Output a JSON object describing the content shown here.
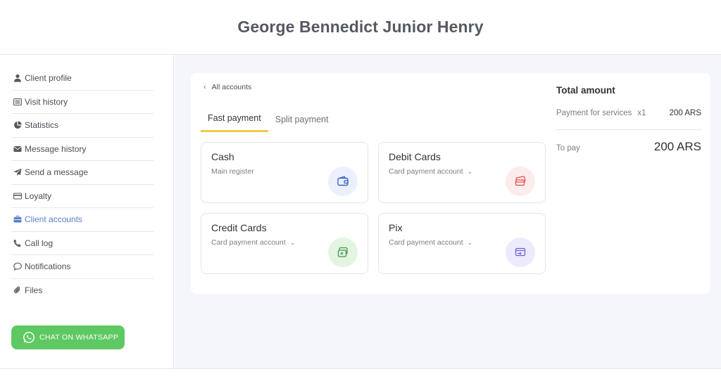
{
  "header": {
    "title": "George Bennedict Junior Henry"
  },
  "sidebar": {
    "items": [
      {
        "label": "Client profile",
        "icon": "user-icon"
      },
      {
        "label": "Visit history",
        "icon": "list-icon"
      },
      {
        "label": "Statistics",
        "icon": "pie-chart-icon"
      },
      {
        "label": "Message history",
        "icon": "envelope-icon"
      },
      {
        "label": "Send a message",
        "icon": "paper-plane-icon"
      },
      {
        "label": "Loyalty",
        "icon": "card-icon"
      },
      {
        "label": "Client accounts",
        "icon": "briefcase-icon",
        "active": true
      },
      {
        "label": "Call log",
        "icon": "phone-icon"
      },
      {
        "label": "Notifications",
        "icon": "comment-icon"
      },
      {
        "label": "Files",
        "icon": "paperclip-icon"
      }
    ],
    "whatsapp_label": "CHAT ON WHATSAPP"
  },
  "main": {
    "back_label": "All accounts",
    "tabs": [
      {
        "label": "Fast payment",
        "active": true
      },
      {
        "label": "Split payment",
        "active": false
      }
    ],
    "methods": [
      {
        "title": "Cash",
        "subtitle": "Main register",
        "dropdown": false,
        "icon": "wallet-icon",
        "badge_color": "#eaf1fd",
        "icon_color": "#3a63c8"
      },
      {
        "title": "Debit Cards",
        "subtitle": "Card payment account",
        "dropdown": true,
        "icon": "cards-icon",
        "badge_color": "#fdecec",
        "icon_color": "#e0504f"
      },
      {
        "title": "Credit Cards",
        "subtitle": "Card payment account",
        "dropdown": true,
        "icon": "credit-card-icon",
        "badge_color": "#e3f4e3",
        "icon_color": "#3c9a45"
      },
      {
        "title": "Pix",
        "subtitle": "Card payment account",
        "dropdown": true,
        "icon": "pix-icon",
        "badge_color": "#ecebfb",
        "icon_color": "#6a63d6"
      }
    ],
    "summary": {
      "title": "Total amount",
      "line_label": "Payment for services",
      "line_qty": "x1",
      "line_amount": "200 ARS",
      "to_pay_label": "To pay",
      "to_pay_amount": "200 ARS"
    }
  },
  "colors": {
    "accent": "#5b7fcc",
    "tab_underline": "#f4c84a",
    "whatsapp": "#5ec962"
  }
}
